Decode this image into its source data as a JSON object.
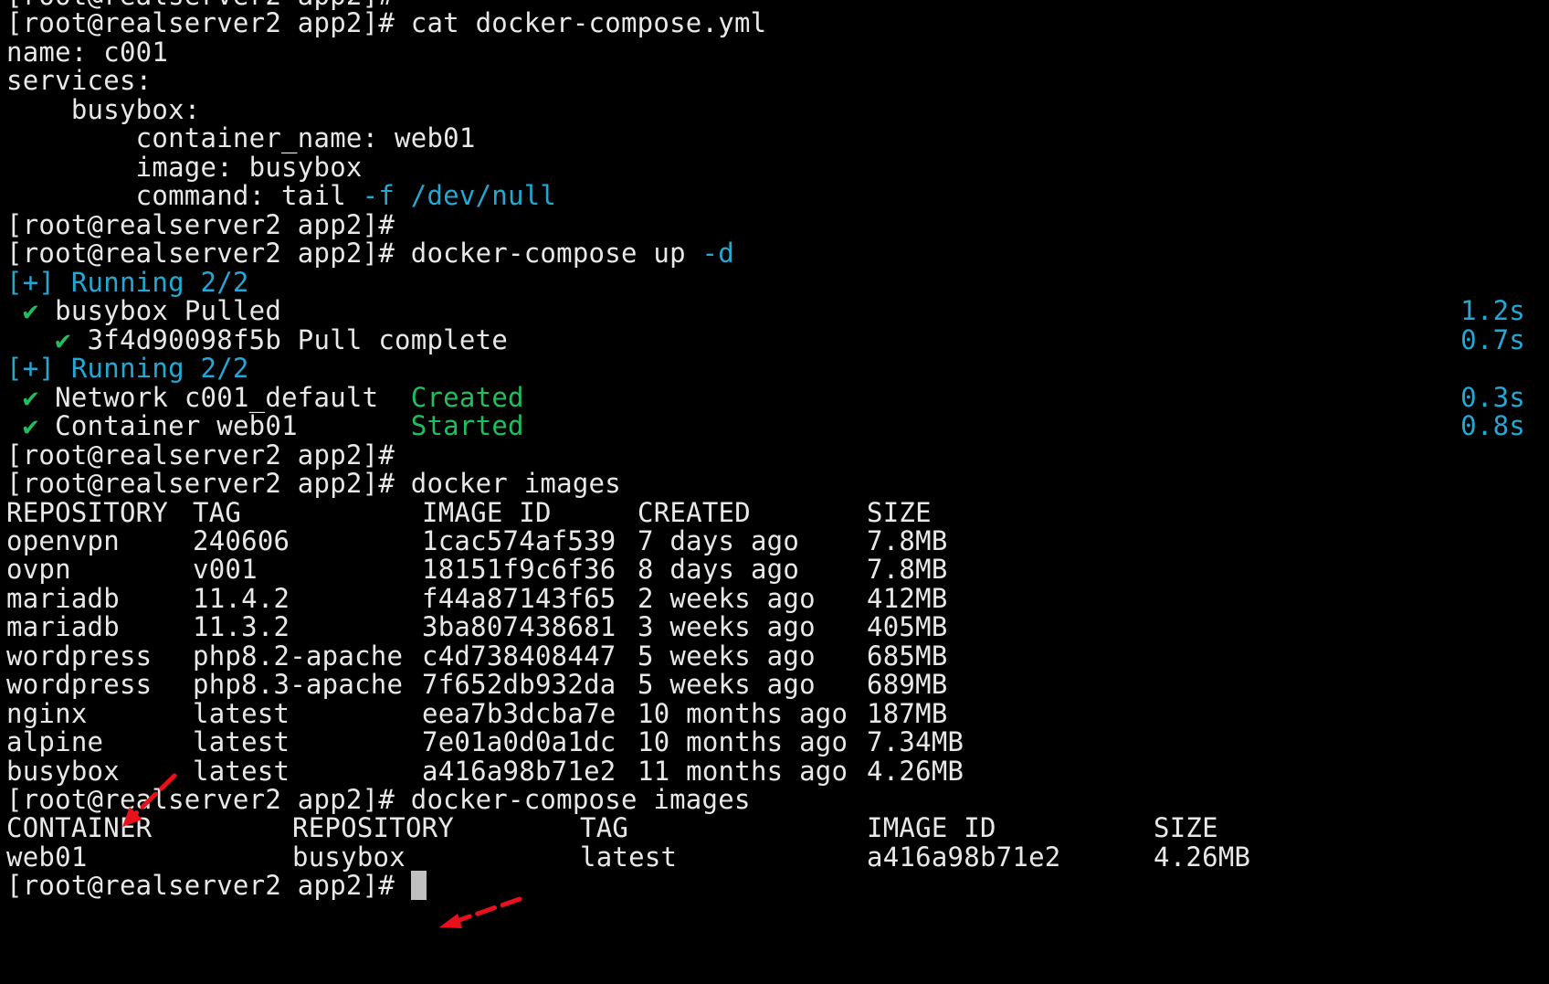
{
  "terminal": {
    "prompt": "[root@realserver2 app2]#",
    "cat_command": "cat docker-compose.yml",
    "yaml": [
      "name: c001",
      "services:",
      "    busybox:",
      "        container_name: web01",
      "        image: busybox"
    ],
    "yaml_command_prefix": "        command: tail ",
    "yaml_command_flag": "-f",
    "yaml_command_path": "/dev/null",
    "compose_up_command": "docker-compose up ",
    "compose_up_flag": "-d",
    "running_label_1": "[+] Running 2/2",
    "pull_steps": [
      {
        "check": "✔",
        "text": "busybox Pulled",
        "indent": " ",
        "time": "1.2s"
      },
      {
        "check": "✔",
        "text": "3f4d90098f5b Pull complete",
        "indent": "   ",
        "time": "0.7s"
      }
    ],
    "running_label_2": "[+] Running 2/2",
    "create_steps": [
      {
        "check": "✔",
        "text": "Network c001_default  ",
        "status": "Created",
        "time": "0.3s"
      },
      {
        "check": "✔",
        "text": "Container web01       ",
        "status": "Started",
        "time": "0.8s"
      }
    ],
    "images_command": "docker images",
    "images_headers": [
      "REPOSITORY",
      "TAG",
      "IMAGE ID",
      "CREATED",
      "SIZE"
    ],
    "images_rows": [
      [
        "openvpn",
        "240606",
        "1cac574af539",
        "7 days ago",
        "7.8MB"
      ],
      [
        "ovpn",
        "v001",
        "18151f9c6f36",
        "8 days ago",
        "7.8MB"
      ],
      [
        "mariadb",
        "11.4.2",
        "f44a87143f65",
        "2 weeks ago",
        "412MB"
      ],
      [
        "mariadb",
        "11.3.2",
        "3ba807438681",
        "3 weeks ago",
        "405MB"
      ],
      [
        "wordpress",
        "php8.2-apache",
        "c4d738408447",
        "5 weeks ago",
        "685MB"
      ],
      [
        "wordpress",
        "php8.3-apache",
        "7f652db932da",
        "5 weeks ago",
        "689MB"
      ],
      [
        "nginx",
        "latest",
        "eea7b3dcba7e",
        "10 months ago",
        "187MB"
      ],
      [
        "alpine",
        "latest",
        "7e01a0d0a1dc",
        "10 months ago",
        "7.34MB"
      ],
      [
        "busybox",
        "latest",
        "a416a98b71e2",
        "11 months ago",
        "4.26MB"
      ]
    ],
    "compose_images_command": "docker-compose images",
    "compose_images_headers": [
      "CONTAINER",
      "REPOSITORY",
      "TAG",
      "IMAGE ID",
      "SIZE"
    ],
    "compose_images_rows": [
      [
        "web01",
        "busybox",
        "latest",
        "a416a98b71e2",
        "4.26MB"
      ]
    ]
  },
  "colors": {
    "background": "#000000",
    "foreground": "#e8e8e8",
    "cyan": "#23a7d3",
    "green": "#1fbf5f",
    "annotation_arrow": "#e8111b"
  }
}
